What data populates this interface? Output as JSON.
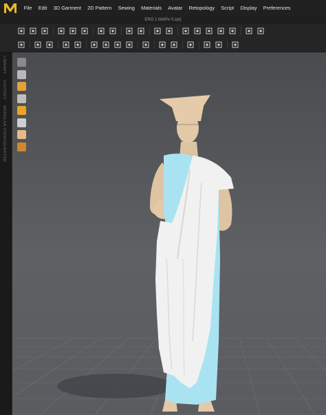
{
  "app": {
    "logo_icon": "marvelous-designer-logo",
    "document_title": "ERO 1 MARV 0.zprj"
  },
  "menu": [
    "File",
    "Edit",
    "3D Garment",
    "2D Pattern",
    "Sewing",
    "Materials",
    "Avatar",
    "Retopology",
    "Script",
    "Display",
    "Preferences"
  ],
  "side_panels": [
    "LIBRARY",
    "HISTORY",
    "MODULAR CONFIGURATOR"
  ],
  "toolbar_row1": [
    "select-move-icon",
    "add-point-icon",
    "transform-icon",
    "sep",
    "edit-pattern-icon",
    "edit-curve-icon",
    "edit-curvature-icon",
    "sep",
    "segment-sewing-icon",
    "free-sewing-icon",
    "sep",
    "tack-icon",
    "pin-icon",
    "sep",
    "line-sewing-icon",
    "check-sewing-icon",
    "sep",
    "show-avatar-icon",
    "garment-icon",
    "layer-icon",
    "arrangement-icon",
    "fold-icon",
    "sep",
    "pin-tool-icon",
    "pen-tool-icon"
  ],
  "toolbar_row2": [
    "simulate-icon",
    "sep",
    "edit-texture-icon",
    "transform-texture-icon",
    "sep",
    "trim-icon",
    "graphic-icon",
    "sep",
    "puckering-icon",
    "zipper-icon",
    "button-icon",
    "buttonhole-icon",
    "sep",
    "tape-icon",
    "sep",
    "measure-icon",
    "circumference-icon",
    "sep",
    "fold-arrangement-icon",
    "sep",
    "strap-icon",
    "layer-clone-icon",
    "sep",
    "avatar-measure-icon"
  ],
  "viewport_tools": [
    "avatar-display-icon",
    "garment-display-icon",
    "texture-display-icon",
    "avatar-skin-icon",
    "fabric-render-icon",
    "particle-icon",
    "skeleton-icon",
    "grid-icon"
  ],
  "colors": {
    "accent_logo": "#e8b92c",
    "garment_white": "#f1f1f1",
    "garment_blue": "#a9e3f2",
    "avatar_skin": "#e2c9a8",
    "viewport_top": "#494b4f",
    "viewport_bottom": "#5a5c60",
    "grid_line": "#6f7176"
  }
}
